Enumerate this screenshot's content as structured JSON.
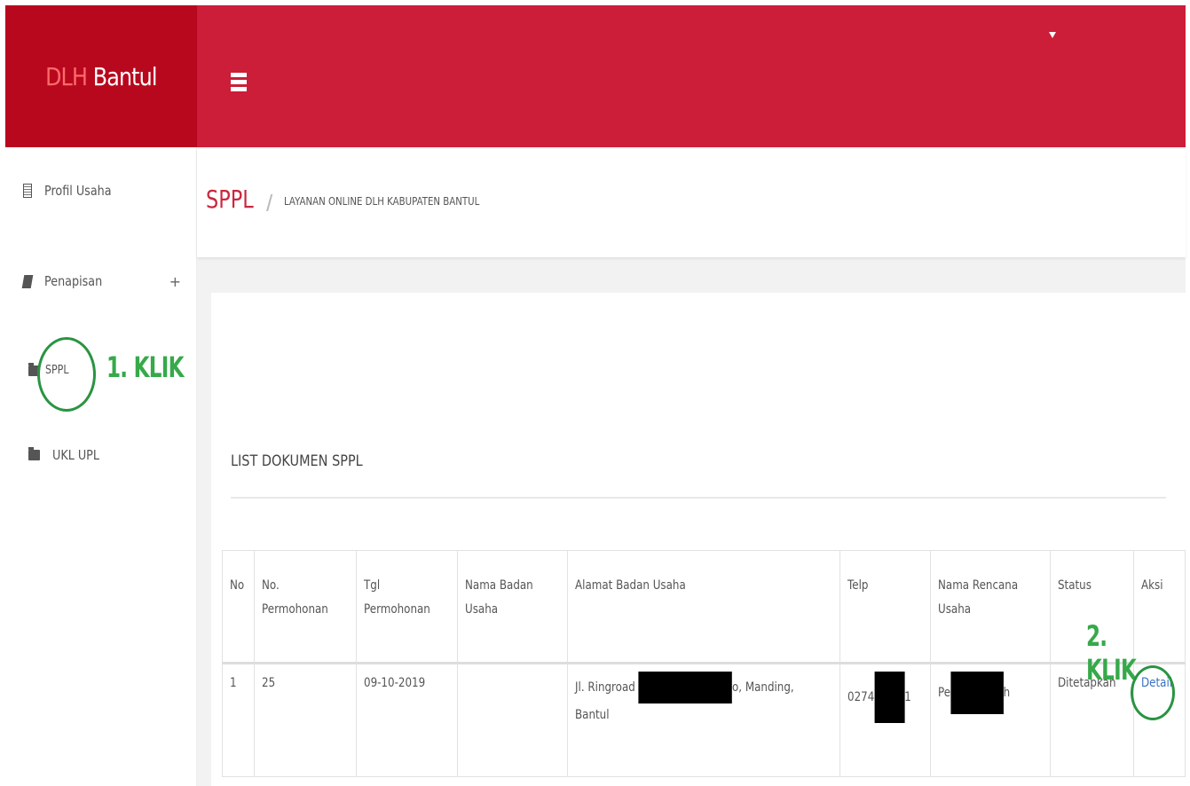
{
  "brand": {
    "accent": "DLH",
    "name": " Bantul"
  },
  "header": {
    "menu_icon": "hamburger-icon",
    "user_menu_icon": "caret-down-icon"
  },
  "sidebar": {
    "items": [
      {
        "label": "Profil Usaha",
        "icon": "document-icon"
      },
      {
        "label": "Penapisan",
        "icon": "book-icon",
        "expand": "+"
      },
      {
        "label": "SPPL",
        "icon": "folder-icon"
      },
      {
        "label": "UKL UPL",
        "icon": "folder-icon"
      }
    ],
    "annotation": "1. KLIK"
  },
  "breadcrumb": {
    "title": "SPPL",
    "separator": "/",
    "subtitle": "LAYANAN ONLINE DLH KABUPATEN BANTUL"
  },
  "list": {
    "title": "LIST DOKUMEN SPPL",
    "annotation": "2. KLIK",
    "columns": [
      "No",
      "No. Permohonan",
      "Tgl Permohonan",
      "Nama Badan Usaha",
      "Alamat Badan Usaha",
      "Telp",
      "Nama Rencana Usaha",
      "Status",
      "Aksi"
    ],
    "rows": [
      {
        "no": "1",
        "no_permohonan": "25",
        "tgl": "09-10-2019",
        "nama_badan": "",
        "alamat_pre": "Jl. Ringroad",
        "alamat_post": "o, Manding,",
        "alamat_line2": "Bantul",
        "telp_pre": "0274",
        "telp_post": "1",
        "rencana_pre": "Pe",
        "rencana_post": "h",
        "status": "Ditetapkan",
        "aksi": "Detail"
      }
    ]
  },
  "colors": {
    "brand_bg": "#b8081e",
    "topbar_bg": "#cc1d39",
    "annotation": "#36a94a",
    "link": "#3b73c2"
  }
}
